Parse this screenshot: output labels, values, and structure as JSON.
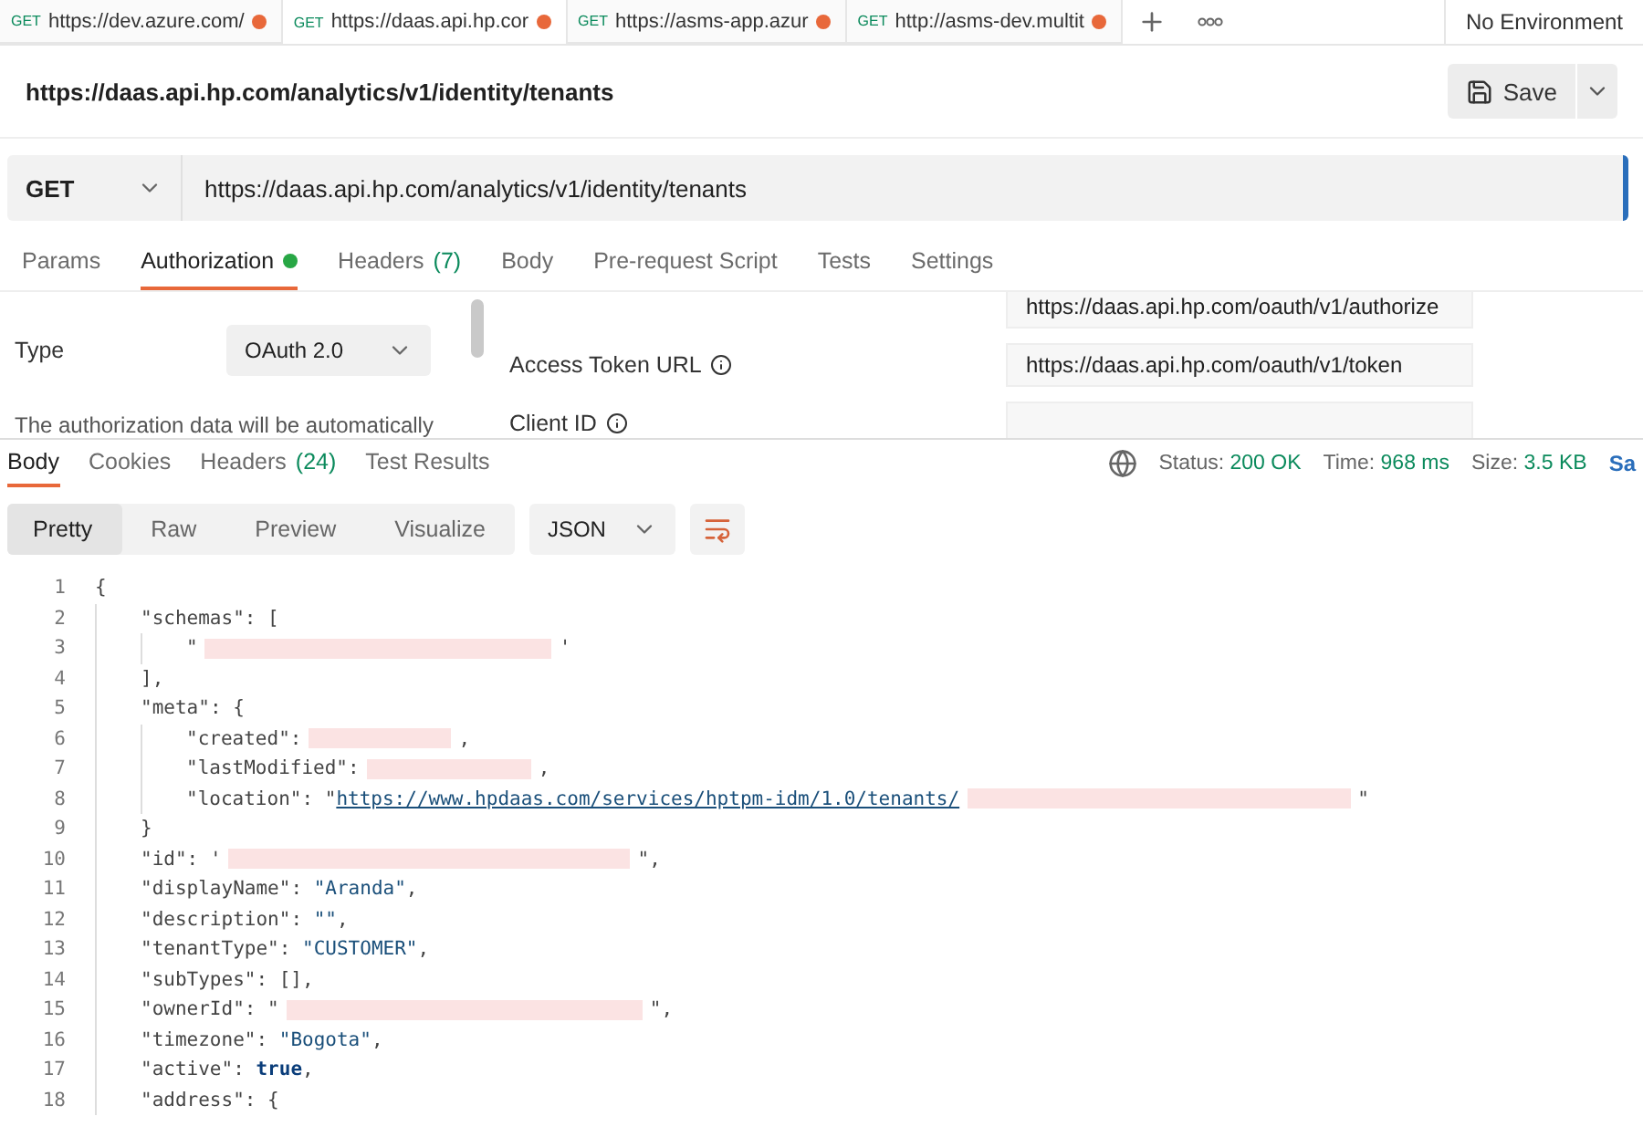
{
  "browser_tabs": [
    {
      "method": "GET",
      "url": "https://dev.azure.com/",
      "unsaved": true,
      "selected": false
    },
    {
      "method": "GET",
      "url": "https://daas.api.hp.cor",
      "unsaved": true,
      "selected": true
    },
    {
      "method": "GET",
      "url": "https://asms-app.azur",
      "unsaved": true,
      "selected": false
    },
    {
      "method": "GET",
      "url": "http://asms-dev.multit",
      "unsaved": true,
      "selected": false
    }
  ],
  "environment": "No Environment",
  "request_title": "https://daas.api.hp.com/analytics/v1/identity/tenants",
  "save_button": "Save",
  "request": {
    "method": "GET",
    "url": "https://daas.api.hp.com/analytics/v1/identity/tenants"
  },
  "request_tabs": [
    {
      "label": "Params",
      "selected": false,
      "dot": false
    },
    {
      "label": "Authorization",
      "selected": true,
      "dot": true
    },
    {
      "label": "Headers",
      "count": "(7)",
      "selected": false,
      "dot": false
    },
    {
      "label": "Body",
      "selected": false,
      "dot": false
    },
    {
      "label": "Pre-request Script",
      "selected": false,
      "dot": false
    },
    {
      "label": "Tests",
      "selected": false,
      "dot": false
    },
    {
      "label": "Settings",
      "selected": false,
      "dot": false
    }
  ],
  "auth": {
    "type_label": "Type",
    "type_value": "OAuth 2.0",
    "note": "The authorization data will be automatically",
    "fields": [
      {
        "value": "https://daas.api.hp.com/oauth/v1/authorize",
        "info": false
      },
      {
        "label": "Access Token URL",
        "value": "https://daas.api.hp.com/oauth/v1/token",
        "info": true
      },
      {
        "label": "Client ID",
        "info": true
      }
    ]
  },
  "response_tabs": [
    {
      "label": "Body",
      "selected": true
    },
    {
      "label": "Cookies",
      "selected": false
    },
    {
      "label": "Headers",
      "count": "(24)",
      "selected": false
    },
    {
      "label": "Test Results",
      "selected": false
    }
  ],
  "status": [
    {
      "label": "Status:",
      "value": "200 OK"
    },
    {
      "label": "Time:",
      "value": "968 ms"
    },
    {
      "label": "Size:",
      "value": "3.5 KB"
    }
  ],
  "save_response": "Sa",
  "view_modes": [
    {
      "label": "Pretty",
      "selected": true
    },
    {
      "label": "Raw",
      "selected": false
    },
    {
      "label": "Preview",
      "selected": false
    },
    {
      "label": "Visualize",
      "selected": false
    }
  ],
  "format": "JSON",
  "code_lines": [
    {
      "number": "1",
      "tokens": [
        {
          "kind": "punct",
          "text": "{"
        }
      ],
      "children": [
        {
          "number": "2",
          "tokens": [
            {
              "kind": "key",
              "text": "\"schemas\""
            },
            {
              "kind": "punct",
              "text": ": ["
            }
          ],
          "children": [
            {
              "number": "3",
              "tokens": [
                {
                  "kind": "punct",
                  "text": "\""
                },
                {
                  "kind": "redacted"
                },
                {
                  "kind": "punct",
                  "text": "'"
                }
              ]
            }
          ]
        },
        {
          "number": "4",
          "tokens": [
            {
              "kind": "punct",
              "text": "],"
            }
          ]
        },
        {
          "number": "5",
          "tokens": [
            {
              "kind": "key",
              "text": "\"meta\""
            },
            {
              "kind": "punct",
              "text": ": {"
            }
          ],
          "children": [
            {
              "number": "6",
              "tokens": [
                {
                  "kind": "key",
                  "text": "\"created\""
                },
                {
                  "kind": "punct",
                  "text": ":"
                },
                {
                  "kind": "redacted"
                },
                {
                  "kind": "punct",
                  "text": ","
                }
              ]
            },
            {
              "number": "7",
              "tokens": [
                {
                  "kind": "key",
                  "text": "\"lastModified\""
                },
                {
                  "kind": "punct",
                  "text": ":"
                },
                {
                  "kind": "redacted"
                },
                {
                  "kind": "punct",
                  "text": ","
                }
              ]
            },
            {
              "number": "8",
              "tokens": [
                {
                  "kind": "key",
                  "text": "\"location\""
                },
                {
                  "kind": "punct",
                  "text": ": \""
                },
                {
                  "kind": "link",
                  "text": "https://www.hpdaas.com/services/hptpm-idm/1.0/tenants/"
                },
                {
                  "kind": "redacted"
                },
                {
                  "kind": "punct",
                  "text": "\""
                }
              ]
            }
          ]
        },
        {
          "number": "9",
          "tokens": [
            {
              "kind": "punct",
              "text": "}"
            }
          ]
        },
        {
          "number": "10",
          "tokens": [
            {
              "kind": "key",
              "text": "\"id\""
            },
            {
              "kind": "punct",
              "text": ": '"
            },
            {
              "kind": "redacted"
            },
            {
              "kind": "punct",
              "text": "\","
            }
          ]
        },
        {
          "number": "11",
          "tokens": [
            {
              "kind": "key",
              "text": "\"displayName\""
            },
            {
              "kind": "punct",
              "text": ": "
            },
            {
              "kind": "string",
              "text": "\"Aranda\""
            },
            {
              "kind": "punct",
              "text": ","
            }
          ]
        },
        {
          "number": "12",
          "tokens": [
            {
              "kind": "key",
              "text": "\"description\""
            },
            {
              "kind": "punct",
              "text": ": "
            },
            {
              "kind": "string",
              "text": "\"\""
            },
            {
              "kind": "punct",
              "text": ","
            }
          ]
        },
        {
          "number": "13",
          "tokens": [
            {
              "kind": "key",
              "text": "\"tenantType\""
            },
            {
              "kind": "punct",
              "text": ": "
            },
            {
              "kind": "string",
              "text": "\"CUSTOMER\""
            },
            {
              "kind": "punct",
              "text": ","
            }
          ]
        },
        {
          "number": "14",
          "tokens": [
            {
              "kind": "key",
              "text": "\"subTypes\""
            },
            {
              "kind": "punct",
              "text": ": [],"
            }
          ]
        },
        {
          "number": "15",
          "tokens": [
            {
              "kind": "key",
              "text": "\"ownerId\""
            },
            {
              "kind": "punct",
              "text": ": \""
            },
            {
              "kind": "redacted"
            },
            {
              "kind": "punct",
              "text": "\","
            }
          ]
        },
        {
          "number": "16",
          "tokens": [
            {
              "kind": "key",
              "text": "\"timezone\""
            },
            {
              "kind": "punct",
              "text": ": "
            },
            {
              "kind": "string",
              "text": "\"Bogota\""
            },
            {
              "kind": "punct",
              "text": ","
            }
          ]
        },
        {
          "number": "17",
          "tokens": [
            {
              "kind": "key",
              "text": "\"active\""
            },
            {
              "kind": "punct",
              "text": ": "
            },
            {
              "kind": "bool",
              "text": "true"
            },
            {
              "kind": "punct",
              "text": ","
            }
          ]
        },
        {
          "number": "18",
          "tokens": [
            {
              "kind": "key",
              "text": "\"address\""
            },
            {
              "kind": "punct",
              "text": ": {"
            }
          ]
        }
      ]
    }
  ]
}
